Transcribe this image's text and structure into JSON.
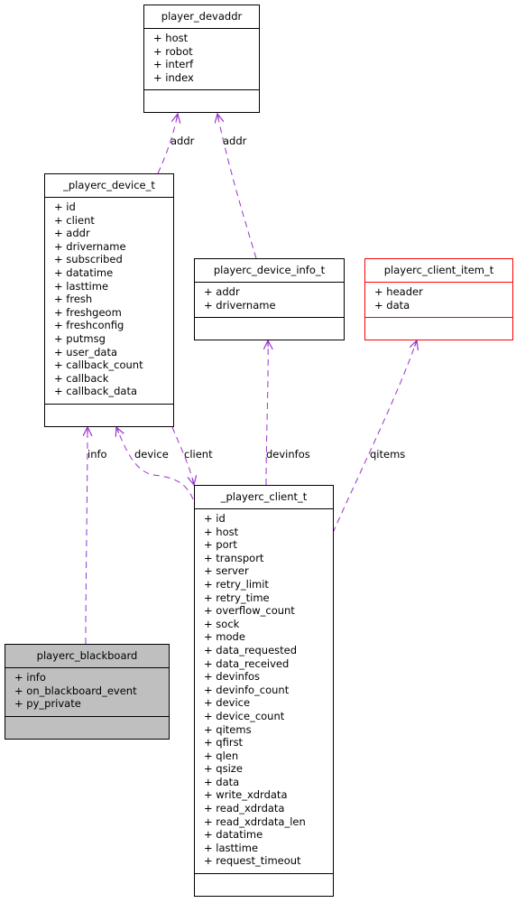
{
  "edge_color": "#9a32cd",
  "classes": {
    "player_devaddr": {
      "name": "player_devaddr",
      "attributes": [
        "+ host",
        "+ robot",
        "+ interf",
        "+ index"
      ]
    },
    "playerc_device_t": {
      "name": "_playerc_device_t",
      "attributes": [
        "+ id",
        "+ client",
        "+ addr",
        "+ drivername",
        "+ subscribed",
        "+ datatime",
        "+ lasttime",
        "+ fresh",
        "+ freshgeom",
        "+ freshconfig",
        "+ putmsg",
        "+ user_data",
        "+ callback_count",
        "+ callback",
        "+ callback_data"
      ]
    },
    "playerc_device_info_t": {
      "name": "playerc_device_info_t",
      "attributes": [
        "+ addr",
        "+ drivername"
      ]
    },
    "playerc_client_item_t": {
      "name": "playerc_client_item_t",
      "attributes": [
        "+ header",
        "+ data"
      ],
      "border_color": "#ff0000"
    },
    "playerc_blackboard": {
      "name": "playerc_blackboard",
      "attributes": [
        "+ info",
        "+ on_blackboard_event",
        "+ py_private"
      ],
      "fill_color": "#bfbfbf"
    },
    "playerc_client_t": {
      "name": "_playerc_client_t",
      "attributes": [
        "+ id",
        "+ host",
        "+ port",
        "+ transport",
        "+ server",
        "+ retry_limit",
        "+ retry_time",
        "+ overflow_count",
        "+ sock",
        "+ mode",
        "+ data_requested",
        "+ data_received",
        "+ devinfos",
        "+ devinfo_count",
        "+ device",
        "+ device_count",
        "+ qitems",
        "+ qfirst",
        "+ qlen",
        "+ qsize",
        "+ data",
        "+ write_xdrdata",
        "+ read_xdrdata",
        "+ read_xdrdata_len",
        "+ datatime",
        "+ lasttime",
        "+ request_timeout"
      ]
    }
  },
  "edges": [
    {
      "from": "_playerc_device_t",
      "to": "player_devaddr",
      "label": "addr"
    },
    {
      "from": "playerc_device_info_t",
      "to": "player_devaddr",
      "label": "addr"
    },
    {
      "from": "playerc_blackboard",
      "to": "_playerc_device_t",
      "label": "info"
    },
    {
      "from": "_playerc_client_t",
      "to": "_playerc_device_t",
      "label": "device"
    },
    {
      "from": "_playerc_device_t",
      "to": "_playerc_client_t",
      "label": "client"
    },
    {
      "from": "_playerc_client_t",
      "to": "playerc_device_info_t",
      "label": "devinfos"
    },
    {
      "from": "_playerc_client_t",
      "to": "playerc_client_item_t",
      "label": "qitems"
    }
  ]
}
